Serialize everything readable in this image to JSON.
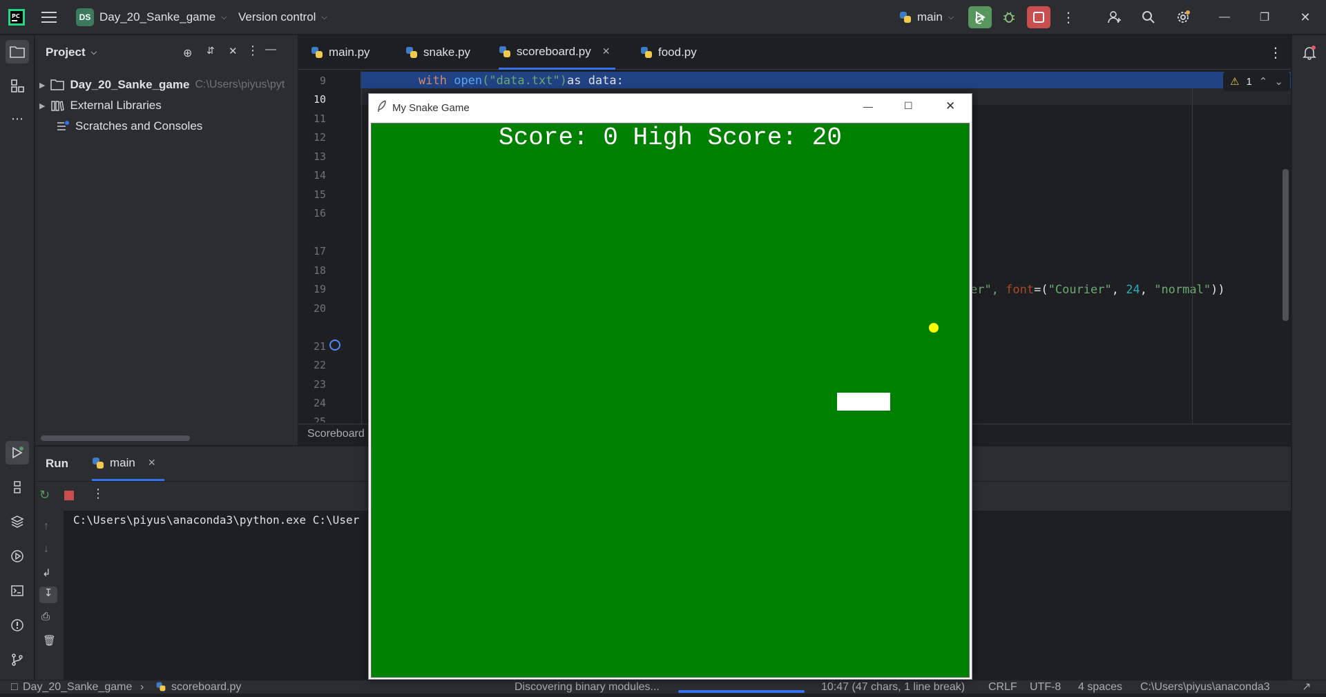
{
  "titlebar": {
    "project_badge": "DS",
    "project_name": "Day_20_Sanke_game",
    "vcs": "Version control",
    "run_config": "main"
  },
  "project_panel": {
    "title": "Project",
    "items": [
      {
        "label": "Day_20_Sanke_game",
        "path": "C:\\Users\\piyus\\pyt"
      },
      {
        "label": "External Libraries"
      },
      {
        "label": "Scratches and Consoles"
      }
    ]
  },
  "tabs": [
    {
      "label": "main.py"
    },
    {
      "label": "snake.py"
    },
    {
      "label": "scoreboard.py",
      "active": true
    },
    {
      "label": "food.py"
    }
  ],
  "editor": {
    "line_numbers": [
      "9",
      "10",
      "11",
      "12",
      "13",
      "14",
      "15",
      "16",
      "17",
      "18",
      "19",
      "20",
      "21",
      "22",
      "23",
      "24",
      "25"
    ],
    "line9_kw": "with",
    "line9_fn": "open",
    "line9_str": "(\"data.txt\")",
    "line9_rest": "as data:",
    "line19_a": "er\", ",
    "line19_b": "font",
    "line19_c": "=(",
    "line19_d": "\"Courier\"",
    "line19_e": ", ",
    "line19_f": "24",
    "line19_g": ", ",
    "line19_h": "\"normal\"",
    "line19_i": "))",
    "warning_count": "1",
    "breadcrumb": "Scoreboard"
  },
  "run_panel": {
    "title": "Run",
    "tab": "main",
    "console_line": "C:\\Users\\piyus\\anaconda3\\python.exe C:\\User"
  },
  "statusbar": {
    "crumb_project": "Day_20_Sanke_game",
    "crumb_file": "scoreboard.py",
    "task": "Discovering binary modules...",
    "task_progress": 1.0,
    "position": "10:47 (47 chars, 1 line break)",
    "line_sep": "CRLF",
    "encoding": "UTF-8",
    "indent": "4 spaces",
    "interpreter": "C:\\Users\\piyus\\anaconda3"
  },
  "game": {
    "window_title": "My Snake Game",
    "score_text": "Score: 0 High Score: 20",
    "background": "#008000",
    "food_color": "#ffff00",
    "snake_color": "#ffffff"
  },
  "colors": {
    "accent_blue": "#3574f0",
    "run_green": "#57965c",
    "stop_red": "#c94f4f"
  }
}
